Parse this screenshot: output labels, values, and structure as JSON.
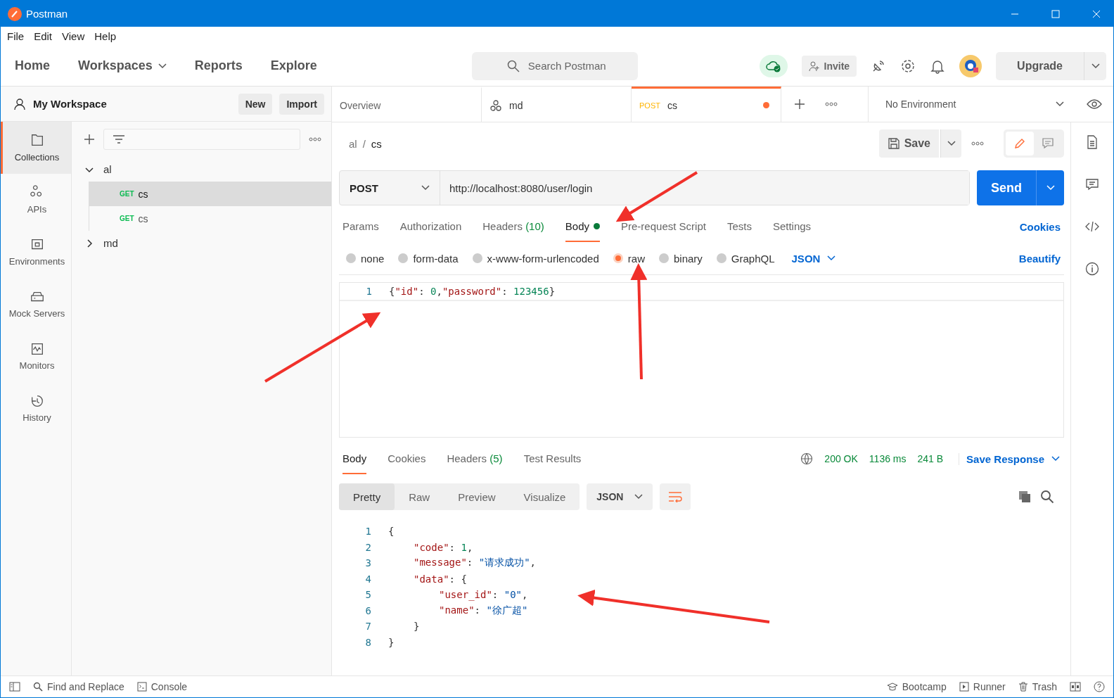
{
  "window": {
    "title": "Postman"
  },
  "menu": [
    "File",
    "Edit",
    "View",
    "Help"
  ],
  "nav": {
    "items": [
      "Home",
      "Workspaces",
      "Reports",
      "Explore"
    ],
    "search_placeholder": "Search Postman",
    "invite": "Invite",
    "upgrade": "Upgrade"
  },
  "sidebar": {
    "workspace": "My Workspace",
    "new_button": "New",
    "import_button": "Import",
    "items": [
      {
        "label": "Collections",
        "selected": true
      },
      {
        "label": "APIs",
        "selected": false
      },
      {
        "label": "Environments",
        "selected": false
      },
      {
        "label": "Mock Servers",
        "selected": false
      },
      {
        "label": "Monitors",
        "selected": false
      },
      {
        "label": "History",
        "selected": false
      }
    ],
    "tree": [
      {
        "name": "al",
        "expanded": true,
        "children": [
          {
            "method": "GET",
            "name": "cs",
            "selected": true
          },
          {
            "method": "GET",
            "name": "cs",
            "selected": false
          }
        ]
      },
      {
        "name": "md",
        "expanded": false
      }
    ]
  },
  "tabs": [
    {
      "kind": "overview",
      "label": "Overview",
      "selected": false,
      "unsaved": false
    },
    {
      "kind": "collection",
      "label": "md",
      "selected": false,
      "unsaved": false
    },
    {
      "kind": "request",
      "method": "POST",
      "label": "cs",
      "selected": true,
      "unsaved": true
    }
  ],
  "environment": "No Environment",
  "breadcrumb": {
    "collection": "al",
    "separator": "/",
    "request": "cs"
  },
  "save_button": "Save",
  "modes": [
    {
      "kind": "edit",
      "selected": true
    },
    {
      "kind": "comment",
      "selected": false
    }
  ],
  "request": {
    "method": "POST",
    "url": "http://localhost:8080/user/login",
    "send": "Send",
    "tabs": [
      {
        "label": "Params",
        "selected": false,
        "dot": false
      },
      {
        "label": "Authorization",
        "selected": false,
        "dot": false
      },
      {
        "label": "Headers",
        "count": "(10)",
        "selected": false,
        "dot": false
      },
      {
        "label": "Body",
        "selected": true,
        "dot": true
      },
      {
        "label": "Pre-request Script",
        "selected": false,
        "dot": false
      },
      {
        "label": "Tests",
        "selected": false,
        "dot": false
      },
      {
        "label": "Settings",
        "selected": false,
        "dot": false
      }
    ],
    "cookies": "Cookies",
    "body_types": [
      {
        "label": "none",
        "selected": false
      },
      {
        "label": "form-data",
        "selected": false
      },
      {
        "label": "x-www-form-urlencoded",
        "selected": false
      },
      {
        "label": "raw",
        "selected": true
      },
      {
        "label": "binary",
        "selected": false
      },
      {
        "label": "GraphQL",
        "selected": false
      }
    ],
    "format": "JSON",
    "beautify": "Beautify",
    "code": [
      {
        "number": "1",
        "tokens": [
          {
            "kind": "punct",
            "text": "{"
          },
          {
            "kind": "key",
            "text": "\"id\""
          },
          {
            "kind": "punct",
            "text": ":"
          },
          {
            "kind": "number",
            "text": "0"
          },
          {
            "kind": "punct",
            "text": ","
          },
          {
            "kind": "key",
            "text": "\"password\""
          },
          {
            "kind": "punct",
            "text": ":"
          },
          {
            "kind": "number",
            "text": "123456"
          },
          {
            "kind": "punct",
            "text": "}"
          }
        ]
      }
    ]
  },
  "response": {
    "tabs": [
      {
        "label": "Body",
        "selected": true
      },
      {
        "label": "Cookies",
        "selected": false
      },
      {
        "label": "Headers",
        "count": "(5)",
        "selected": false
      },
      {
        "label": "Test Results",
        "selected": false
      }
    ],
    "status": "200 OK",
    "time": "1136 ms",
    "size": "241 B",
    "save_response": "Save Response",
    "views": [
      {
        "label": "Pretty",
        "selected": true
      },
      {
        "label": "Raw",
        "selected": false
      },
      {
        "label": "Preview",
        "selected": false
      },
      {
        "label": "Visualize",
        "selected": false
      }
    ],
    "format": "JSON",
    "code": [
      {
        "number": "1",
        "tokens": [
          {
            "kind": "punct",
            "text": "{"
          }
        ],
        "children": [
          {
            "number": "2",
            "tokens": [
              {
                "kind": "key",
                "text": "\"code\""
              },
              {
                "kind": "punct",
                "text": ":"
              },
              {
                "kind": "number",
                "text": "1"
              },
              {
                "kind": "punct",
                "text": ","
              }
            ]
          },
          {
            "number": "3",
            "tokens": [
              {
                "kind": "key",
                "text": "\"message\""
              },
              {
                "kind": "punct",
                "text": ":"
              },
              {
                "kind": "string",
                "text": "\"请求成功\""
              },
              {
                "kind": "punct",
                "text": ","
              }
            ]
          },
          {
            "number": "4",
            "tokens": [
              {
                "kind": "key",
                "text": "\"data\""
              },
              {
                "kind": "punct",
                "text": ":"
              },
              {
                "kind": "punct",
                "text": "{"
              }
            ],
            "children": [
              {
                "number": "5",
                "tokens": [
                  {
                    "kind": "key",
                    "text": "\"user_id\""
                  },
                  {
                    "kind": "punct",
                    "text": ":"
                  },
                  {
                    "kind": "string",
                    "text": "\"0\""
                  },
                  {
                    "kind": "punct",
                    "text": ","
                  }
                ]
              },
              {
                "number": "6",
                "tokens": [
                  {
                    "kind": "key",
                    "text": "\"name\""
                  },
                  {
                    "kind": "punct",
                    "text": ":"
                  },
                  {
                    "kind": "string",
                    "text": "\"徐广超\""
                  }
                ]
              }
            ]
          },
          {
            "number": "7",
            "tokens": [
              {
                "kind": "punct",
                "text": "}"
              }
            ]
          }
        ]
      },
      {
        "number": "8",
        "tokens": [
          {
            "kind": "punct",
            "text": "}"
          }
        ]
      }
    ]
  },
  "status_bar": {
    "left": [
      "Find and Replace",
      "Console"
    ],
    "right": [
      "Bootcamp",
      "Runner",
      "Trash"
    ]
  }
}
